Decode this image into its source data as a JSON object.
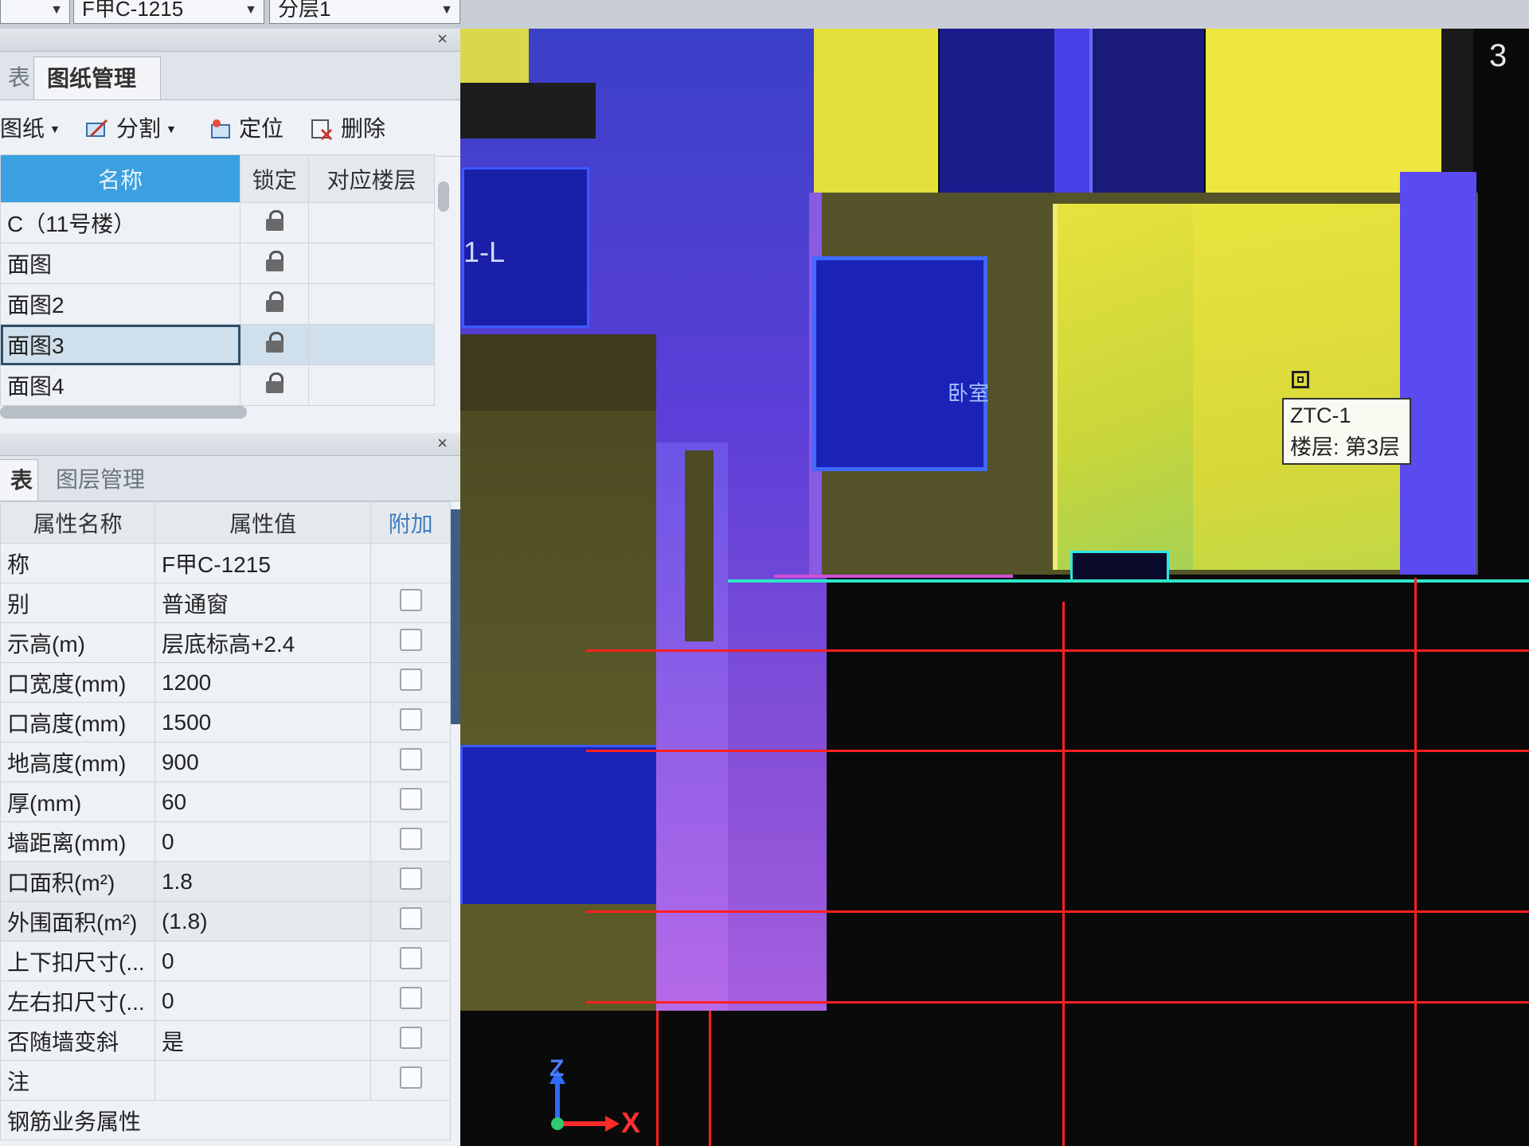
{
  "toolbar": {
    "combo1": "",
    "combo2": "F甲C-1215",
    "combo3": "分层1"
  },
  "drawings_panel": {
    "tabs": [
      "表",
      "图纸管理"
    ],
    "actions": {
      "drawing": "图纸",
      "split": "分割",
      "locate": "定位",
      "delete": "删除"
    },
    "columns": {
      "name": "名称",
      "lock": "锁定",
      "floor": "对应楼层"
    },
    "rows": [
      {
        "name": "C（11号楼）"
      },
      {
        "name": "面图"
      },
      {
        "name": "面图2"
      },
      {
        "name": "面图3"
      },
      {
        "name": "面图4"
      }
    ]
  },
  "props_panel": {
    "tabs": [
      "表",
      "图层管理"
    ],
    "columns": {
      "name": "属性名称",
      "value": "属性值",
      "extra": "附加"
    },
    "rows": [
      {
        "name": "称",
        "value": "F甲C-1215"
      },
      {
        "name": "别",
        "value": "普通窗"
      },
      {
        "name": "示高(m)",
        "value": "层底标高+2.4"
      },
      {
        "name": "口宽度(mm)",
        "value": "1200"
      },
      {
        "name": "口高度(mm)",
        "value": "1500"
      },
      {
        "name": "地高度(mm)",
        "value": "900"
      },
      {
        "name": "厚(mm)",
        "value": "60"
      },
      {
        "name": "墙距离(mm)",
        "value": "0"
      },
      {
        "name": "口面积(m²)",
        "value": "1.8"
      },
      {
        "name": "外围面积(m²)",
        "value": "(1.8)"
      },
      {
        "name": "上下扣尺寸(...",
        "value": "0"
      },
      {
        "name": "左右扣尺寸(...",
        "value": "0"
      },
      {
        "name": "否随墙变斜",
        "value": "是"
      },
      {
        "name": "注",
        "value": ""
      },
      {
        "name": "钢筋业务属性",
        "value": ""
      }
    ]
  },
  "canvas": {
    "tooltip_title": "ZTC-1",
    "tooltip_floor": "楼层: 第3层",
    "corner_label": "3",
    "room_label": "卧室",
    "axis_label_l": "1-L",
    "axis_x": "X",
    "axis_z": "Z"
  },
  "colors": {
    "accent": "#3aa0e0",
    "grid_line": "#ff2020",
    "yellow_zone": "#e4df3a",
    "blue_zone": "#3a4ef0"
  }
}
